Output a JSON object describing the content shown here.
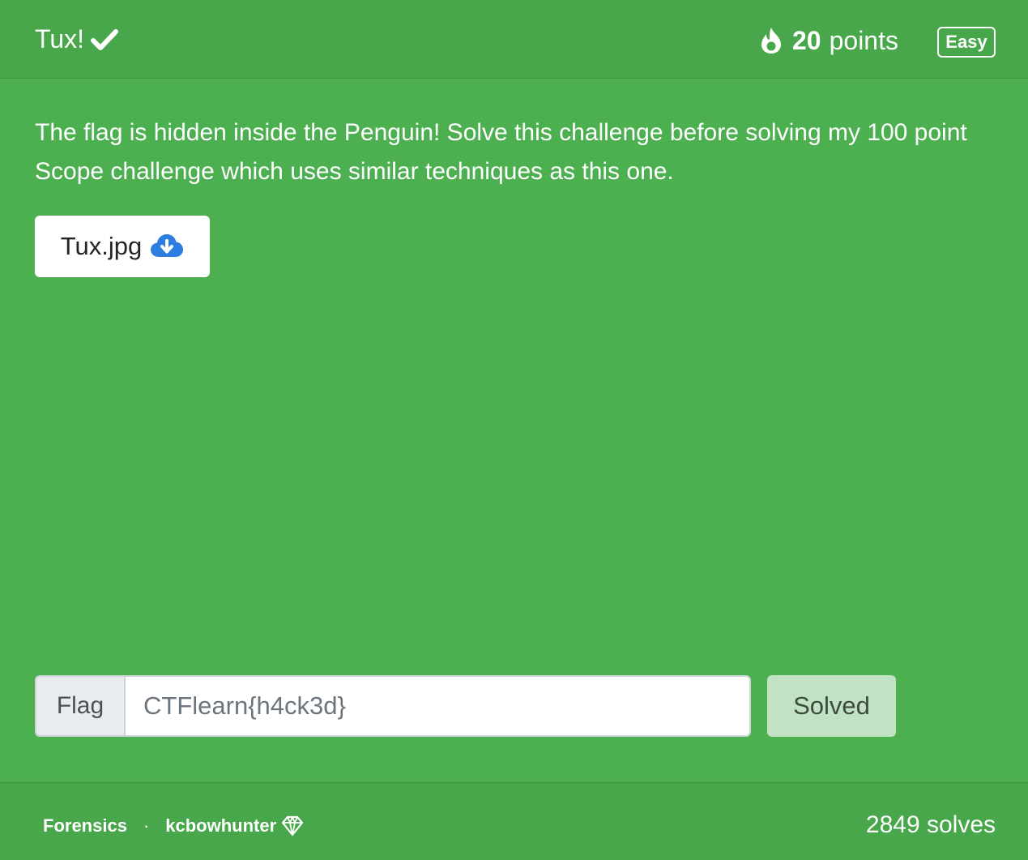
{
  "header": {
    "title": "Tux!",
    "solved_check_icon": "check-icon",
    "flame_icon": "flame-icon",
    "points_value": "20",
    "points_unit": "points",
    "difficulty": "Easy"
  },
  "body": {
    "description": "The flag is hidden inside the Penguin! Solve this challenge before solving my 100 point Scope challenge which uses similar techniques as this one.",
    "file": {
      "name": "Tux.jpg",
      "icon": "cloud-download-icon"
    },
    "flag_form": {
      "label": "Flag",
      "value": "",
      "placeholder": "CTFlearn{h4ck3d}",
      "submit_label": "Solved"
    }
  },
  "footer": {
    "category": "Forensics",
    "separator": "·",
    "author": "kcbowhunter",
    "author_badge_icon": "gem-icon",
    "solves": "2849 solves"
  },
  "colors": {
    "card_bg": "#4caf50",
    "header_bg": "#47a74a",
    "solved_button_bg": "#c1e2c3",
    "file_icon": "#2e7de0"
  }
}
